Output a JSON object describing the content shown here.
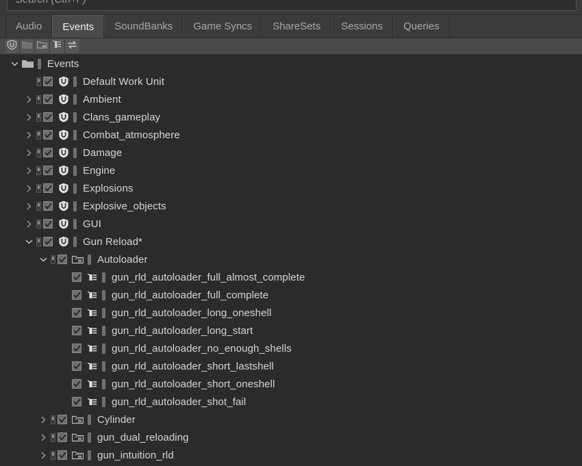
{
  "search": {
    "placeholder": "Search (Ctrl+F)",
    "value": "",
    "icon": "search-icon"
  },
  "tabs": [
    {
      "label": "Audio",
      "active": false
    },
    {
      "label": "Events",
      "active": true
    },
    {
      "label": "SoundBanks",
      "active": false
    },
    {
      "label": "Game Syncs",
      "active": false
    },
    {
      "label": "ShareSets",
      "active": false
    },
    {
      "label": "Sessions",
      "active": false
    },
    {
      "label": "Queries",
      "active": false
    }
  ],
  "toolbar": {
    "buttons": [
      {
        "icon": "event-new-icon",
        "title": "New Event"
      },
      {
        "icon": "folder-new-icon",
        "title": "New Folder"
      },
      {
        "icon": "work-unit-new-icon",
        "title": "New Work Unit"
      },
      {
        "icon": "mixer-icon",
        "title": "Properties"
      },
      {
        "icon": "swap-arrows-icon",
        "title": "Switch"
      }
    ]
  },
  "theme": {
    "background": "#2b2b2b",
    "panel": "#3b3b3b",
    "tab_active": "#4a4a4a",
    "toolbar": "#4a4a4a",
    "text": "#d6d6d6",
    "text_dim": "#a8a8a8",
    "color_swatch": "#707070"
  },
  "tree": {
    "rows": [
      {
        "indent": 0,
        "twisty": "down",
        "inclusion": false,
        "checkbox": false,
        "icon": "folder-icon",
        "swatch": true,
        "label": "Events"
      },
      {
        "indent": 1,
        "twisty": "none",
        "inclusion": true,
        "checkbox": true,
        "icon": "event-icon",
        "swatch": true,
        "label": "Default Work Unit"
      },
      {
        "indent": 1,
        "twisty": "right",
        "inclusion": true,
        "checkbox": true,
        "icon": "event-icon",
        "swatch": true,
        "label": "Ambient"
      },
      {
        "indent": 1,
        "twisty": "right",
        "inclusion": true,
        "checkbox": true,
        "icon": "event-icon",
        "swatch": true,
        "label": "Clans_gameplay"
      },
      {
        "indent": 1,
        "twisty": "right",
        "inclusion": true,
        "checkbox": true,
        "icon": "event-icon",
        "swatch": true,
        "label": "Combat_atmosphere"
      },
      {
        "indent": 1,
        "twisty": "right",
        "inclusion": true,
        "checkbox": true,
        "icon": "event-icon",
        "swatch": true,
        "label": "Damage"
      },
      {
        "indent": 1,
        "twisty": "right",
        "inclusion": true,
        "checkbox": true,
        "icon": "event-icon",
        "swatch": true,
        "label": "Engine"
      },
      {
        "indent": 1,
        "twisty": "right",
        "inclusion": true,
        "checkbox": true,
        "icon": "event-icon",
        "swatch": true,
        "label": "Explosions"
      },
      {
        "indent": 1,
        "twisty": "right",
        "inclusion": true,
        "checkbox": true,
        "icon": "event-icon",
        "swatch": true,
        "label": "Explosive_objects"
      },
      {
        "indent": 1,
        "twisty": "right",
        "inclusion": true,
        "checkbox": true,
        "icon": "event-icon",
        "swatch": true,
        "label": "GUI"
      },
      {
        "indent": 1,
        "twisty": "down",
        "inclusion": true,
        "checkbox": true,
        "icon": "event-icon",
        "swatch": true,
        "label": "Gun Reload*"
      },
      {
        "indent": 2,
        "twisty": "down",
        "inclusion": true,
        "checkbox": true,
        "icon": "virtual-folder-icon",
        "swatch": true,
        "label": "Autoloader"
      },
      {
        "indent": 3,
        "twisty": "none",
        "inclusion": false,
        "checkbox": true,
        "icon": "event-action-icon",
        "swatch": true,
        "label": "gun_rld_autoloader_full_almost_complete"
      },
      {
        "indent": 3,
        "twisty": "none",
        "inclusion": false,
        "checkbox": true,
        "icon": "event-action-icon",
        "swatch": true,
        "label": "gun_rld_autoloader_full_complete"
      },
      {
        "indent": 3,
        "twisty": "none",
        "inclusion": false,
        "checkbox": true,
        "icon": "event-action-icon",
        "swatch": true,
        "label": "gun_rld_autoloader_long_oneshell"
      },
      {
        "indent": 3,
        "twisty": "none",
        "inclusion": false,
        "checkbox": true,
        "icon": "event-action-icon",
        "swatch": true,
        "label": "gun_rld_autoloader_long_start"
      },
      {
        "indent": 3,
        "twisty": "none",
        "inclusion": false,
        "checkbox": true,
        "icon": "event-action-icon",
        "swatch": true,
        "label": "gun_rld_autoloader_no_enough_shells"
      },
      {
        "indent": 3,
        "twisty": "none",
        "inclusion": false,
        "checkbox": true,
        "icon": "event-action-icon",
        "swatch": true,
        "label": "gun_rld_autoloader_short_lastshell"
      },
      {
        "indent": 3,
        "twisty": "none",
        "inclusion": false,
        "checkbox": true,
        "icon": "event-action-icon",
        "swatch": true,
        "label": "gun_rld_autoloader_short_oneshell"
      },
      {
        "indent": 3,
        "twisty": "none",
        "inclusion": false,
        "checkbox": true,
        "icon": "event-action-icon",
        "swatch": true,
        "label": "gun_rld_autoloader_shot_fail"
      },
      {
        "indent": 2,
        "twisty": "right",
        "inclusion": true,
        "checkbox": true,
        "icon": "virtual-folder-icon",
        "swatch": true,
        "label": "Cylinder"
      },
      {
        "indent": 2,
        "twisty": "right",
        "inclusion": true,
        "checkbox": true,
        "icon": "virtual-folder-icon",
        "swatch": true,
        "label": "gun_dual_reloading"
      },
      {
        "indent": 2,
        "twisty": "right",
        "inclusion": true,
        "checkbox": true,
        "icon": "virtual-folder-icon",
        "swatch": true,
        "label": "gun_intuition_rld"
      }
    ]
  }
}
